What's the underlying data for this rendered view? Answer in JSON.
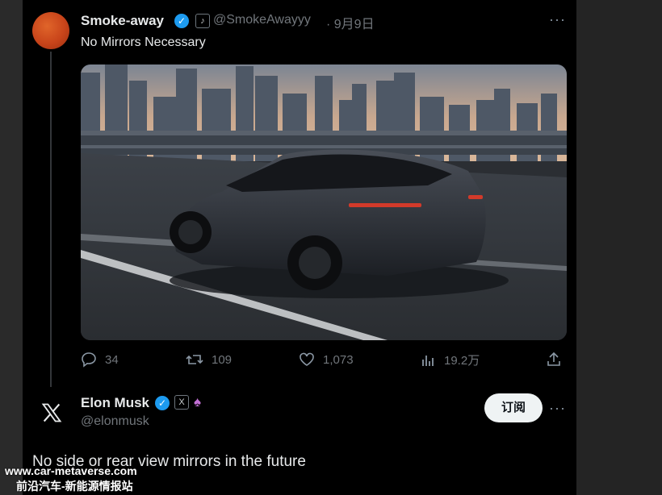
{
  "tweet1": {
    "name": "Smoke-away",
    "handle": "@SmokeAwayyy",
    "date": "· 9月9日",
    "text": "No Mirrors Necessary",
    "more": "···",
    "image_alt": "Dark futuristic mirrorless SUV driving on a highway with a city skyline in the background",
    "actions": {
      "replies": "34",
      "retweets": "109",
      "likes": "1,073",
      "views": "19.2万"
    }
  },
  "tweet2": {
    "name": "Elon Musk",
    "handle": "@elonmusk",
    "subscribe_label": "订阅",
    "more": "···",
    "text": "No side or rear view mirrors in the future",
    "badge_x": "X"
  },
  "watermark": {
    "line1": "www.car-metaverse.com",
    "line2": "前沿汽车-新能源情报站"
  },
  "colors": {
    "verified": "#1d9bf0",
    "background": "#000000",
    "muted_text": "#71767b"
  }
}
